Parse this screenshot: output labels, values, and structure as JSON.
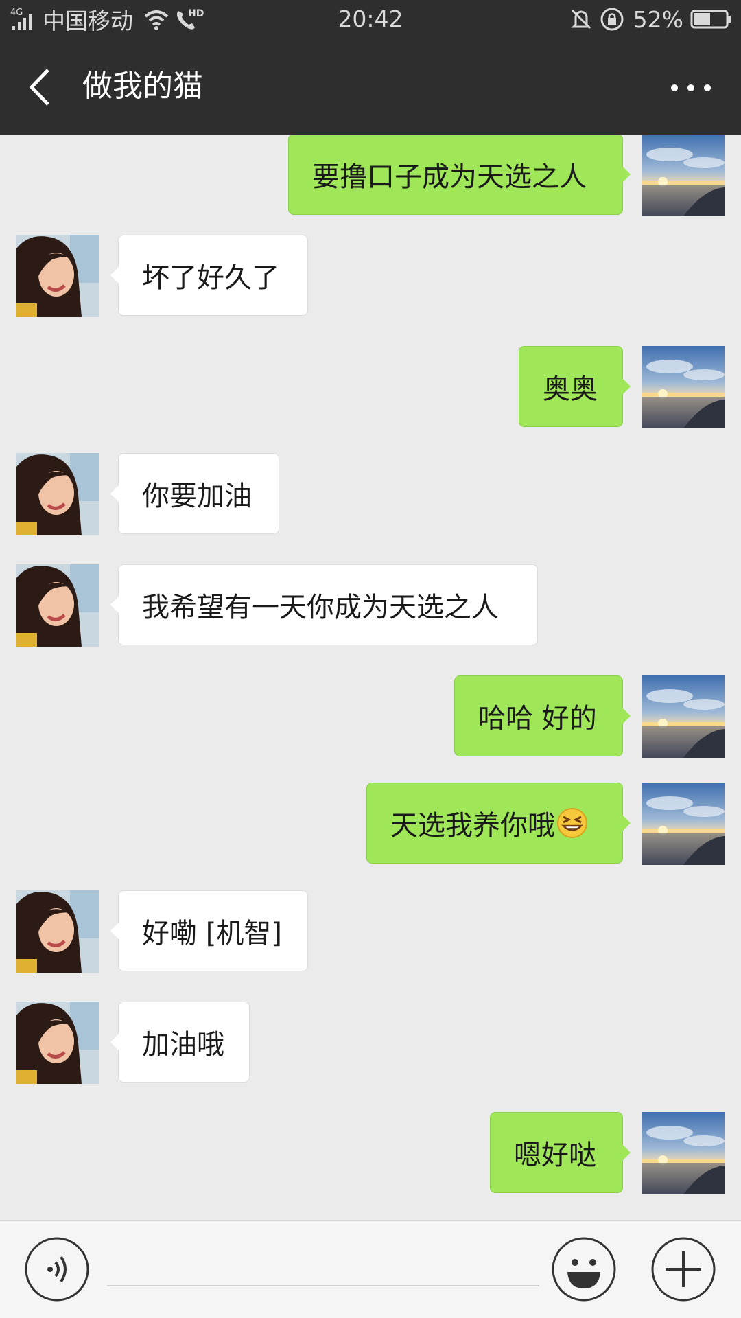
{
  "status_bar": {
    "network_type": "4G",
    "carrier": "中国移动",
    "hd_label": "HD",
    "time": "20:42",
    "battery_percent": "52%",
    "battery_level": 0.52
  },
  "header": {
    "title": "做我的猫",
    "back_icon": "chevron-left-icon",
    "more_icon": "more-dots-icon"
  },
  "messages": [
    {
      "direction": "out",
      "text": "要撸口子成为天选之人",
      "avatar": "sunset-avatar"
    },
    {
      "direction": "in",
      "text": "坏了好久了",
      "avatar": "girl-avatar"
    },
    {
      "direction": "out",
      "text": "奥奥",
      "avatar": "sunset-avatar"
    },
    {
      "direction": "in",
      "text": "你要加油",
      "avatar": "girl-avatar"
    },
    {
      "direction": "in",
      "text": "我希望有一天你成为天选之人",
      "avatar": "girl-avatar"
    },
    {
      "direction": "out",
      "text": "哈哈 好的",
      "avatar": "sunset-avatar"
    },
    {
      "direction": "out",
      "text": "天选我养你哦",
      "emoji": "grin-squint-emoji",
      "avatar": "sunset-avatar"
    },
    {
      "direction": "in",
      "text": "好嘞 [机智]",
      "avatar": "girl-avatar"
    },
    {
      "direction": "in",
      "text": "加油哦",
      "avatar": "girl-avatar"
    },
    {
      "direction": "out",
      "text": "嗯好哒",
      "avatar": "sunset-avatar"
    }
  ],
  "input_bar": {
    "value": "",
    "voice_icon": "voice-icon",
    "emoji_icon": "emoji-icon",
    "plus_icon": "plus-icon"
  },
  "colors": {
    "header_bg": "#2e2e2e",
    "chat_bg": "#ebebeb",
    "outgoing_bubble": "#9fe658",
    "incoming_bubble": "#ffffff"
  }
}
